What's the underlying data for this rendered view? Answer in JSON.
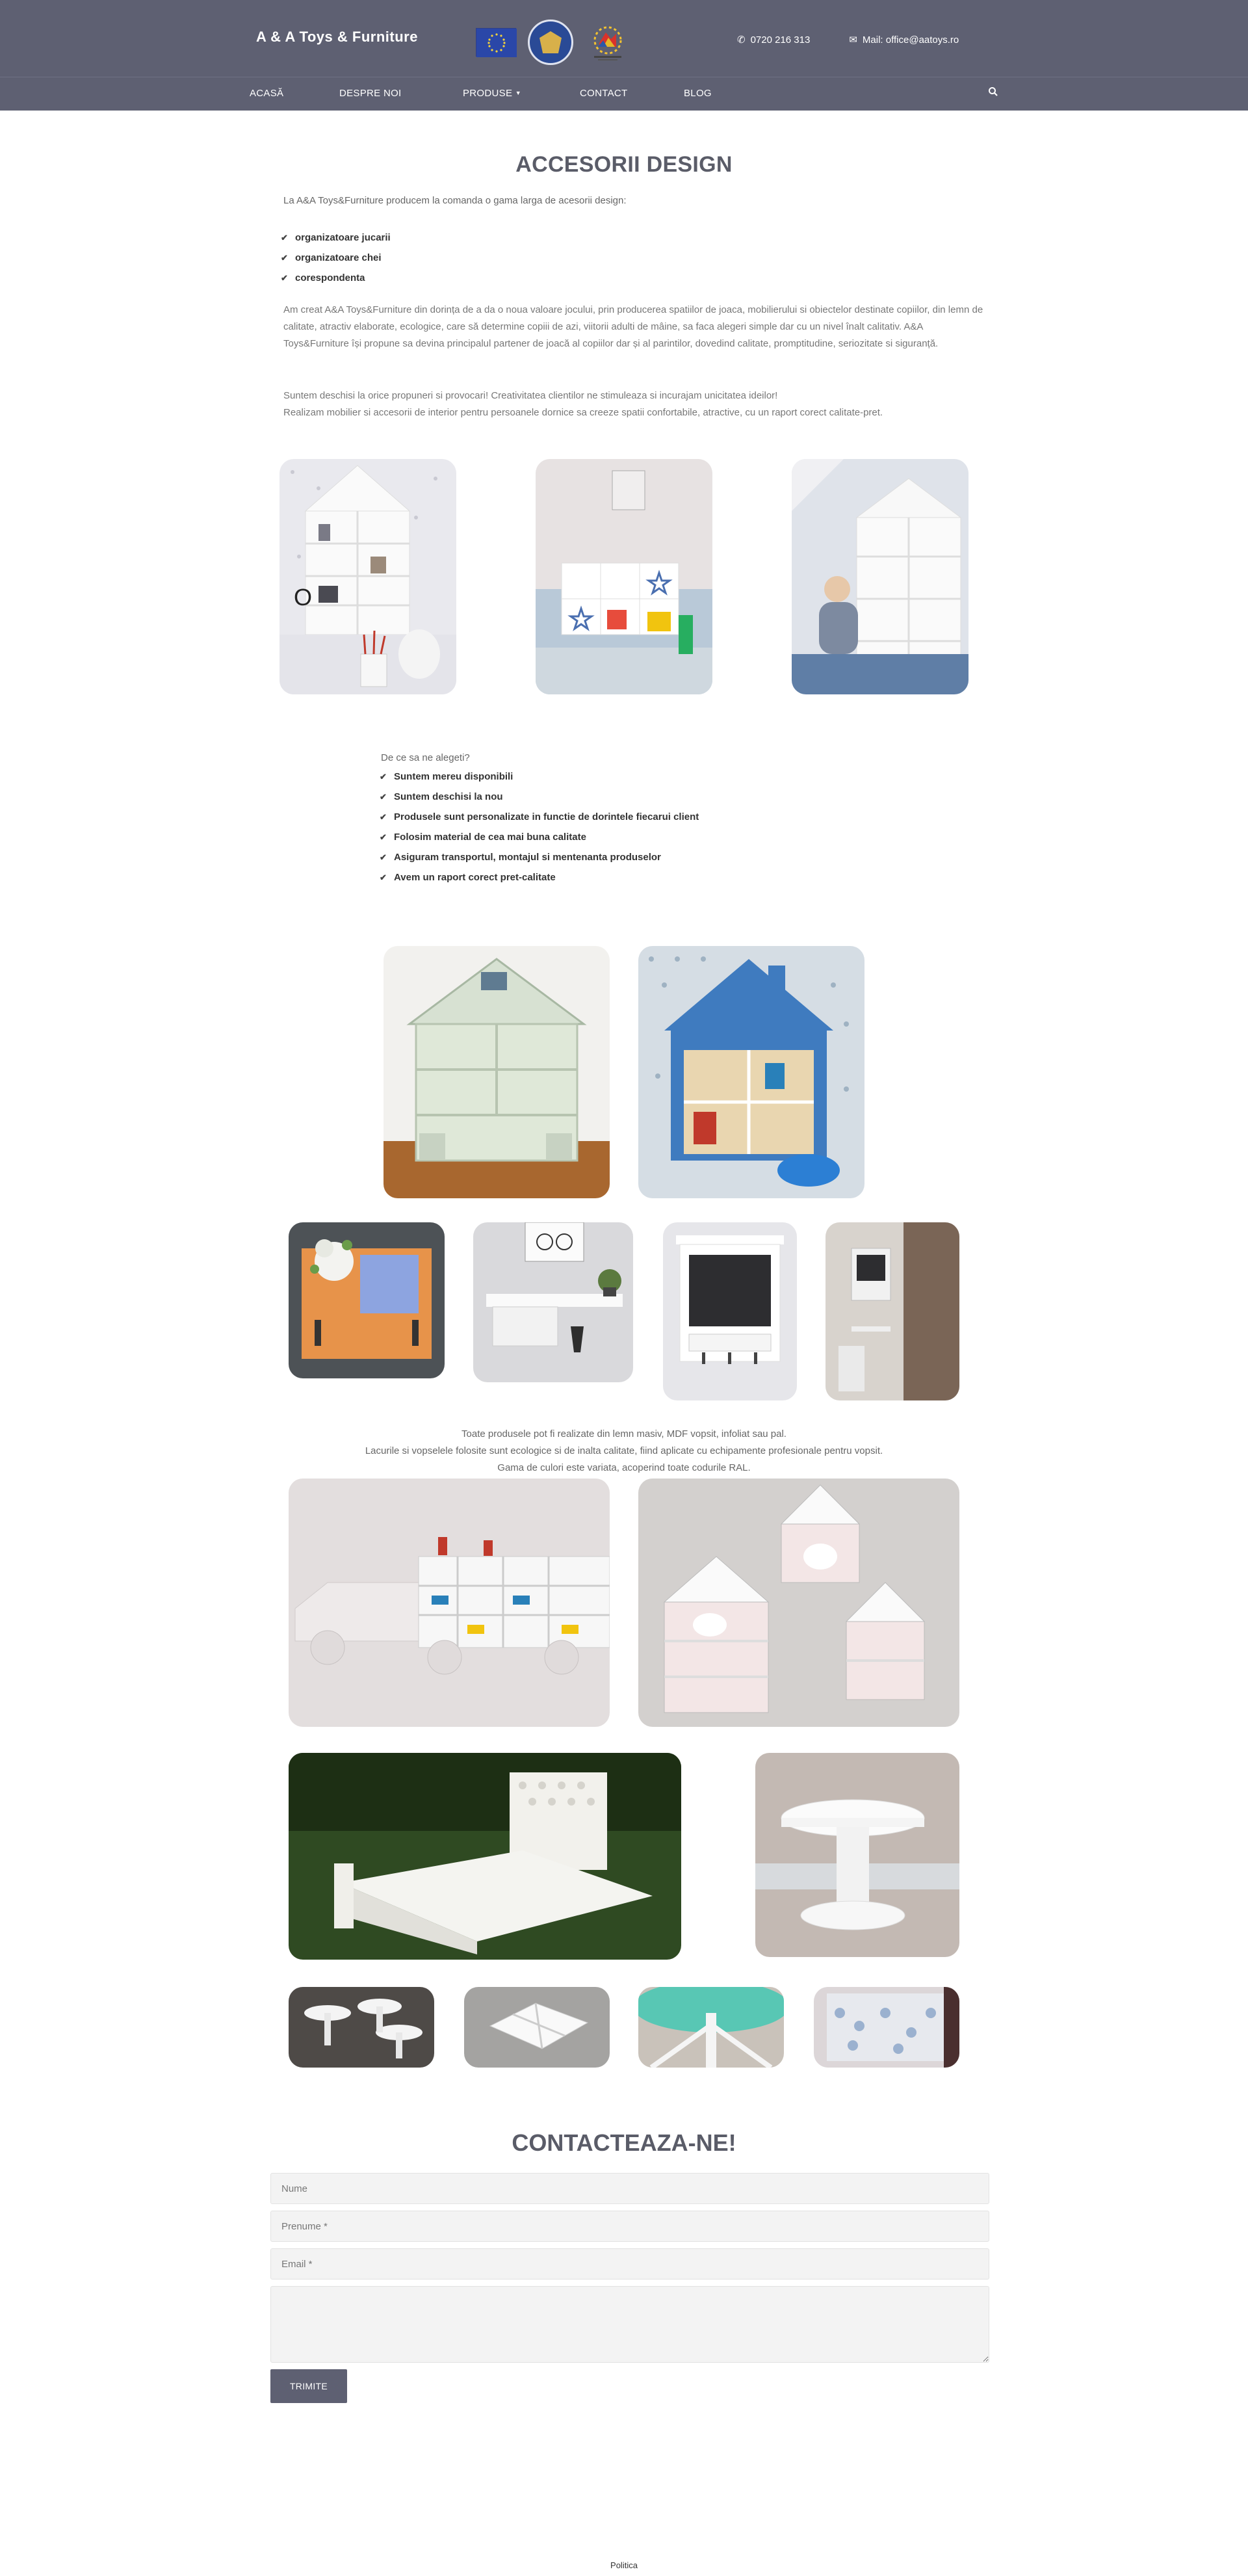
{
  "header": {
    "brand": "A & A Toys & Furniture",
    "phone": "0720 216 313",
    "mail": "Mail: office@aatoys.ro",
    "logos": [
      "eu-flag-logo",
      "romanian-government-seal-logo",
      "regio-programme-logo"
    ]
  },
  "nav": {
    "items": [
      {
        "label": "ACASĂ"
      },
      {
        "label": "DESPRE NOI"
      },
      {
        "label": "PRODUSE"
      },
      {
        "label": "CONTACT"
      },
      {
        "label": "BLOG"
      }
    ],
    "dropdown_icon": "chevron-down-icon",
    "search_icon": "search-icon"
  },
  "main": {
    "title": "ACCESORII DESIGN",
    "intro": "La A&A Toys&Furniture producem la comanda o gama larga de acesorii design:",
    "categories": [
      "organizatoare jucarii",
      "organizatoare chei",
      "corespondenta"
    ],
    "paragraph1": "Am creat A&A Toys&Furniture din dorința de a da o noua valoare jocului, prin producerea spatiilor de joaca, mobilierului si obiectelor destinate copiilor, din lemn de calitate, atractiv elaborate, ecologice, care să determine copiii de azi, viitorii adulti de mâine, sa faca alegeri simple dar cu un nivel înalt calitativ. A&A Toys&Furniture își propune sa devina principalul partener de joacă al copiilor dar și al parintilor, dovedind calitate, promptitudine, seriozitate si siguranță.",
    "paragraph2_line1": "Suntem deschisi la orice propuneri si provocari! Creativitatea clientilor ne stimuleaza si incurajam unicitatea ideilor!",
    "paragraph2_line2": "Realizam mobilier si accesorii de interior pentru persoanele dornice sa creeze spatii confortabile, atractive, cu un raport corect calitate-pret.",
    "why_title": "De ce sa ne alegeti?",
    "reasons": [
      "Suntem mereu disponibili",
      "Suntem deschisi la nou",
      "Produsele sunt personalizate in functie de dorintele fiecarui client",
      "Folosim material de cea mai buna calitate",
      "Asiguram transportul, montajul si mentenanta produselor",
      "Avem un raport corect pret-calitate"
    ],
    "disclaimer_lines": [
      "Toate produsele pot fi realizate din lemn masiv, MDF vopsit, infoliat sau pal.",
      "Lacurile si vopselele folosite sunt ecologice si de inalta calitate, fiind aplicate cu echipamente profesionale pentru vopsit.",
      "Gama de culori este variata, acoperind toate codurile RAL."
    ]
  },
  "contact": {
    "title": "CONTACTEAZA-NE!",
    "name_placeholder": "Nume",
    "firstname_placeholder": "Prenume *",
    "email_placeholder": "Email *",
    "message_placeholder": "",
    "submit_label": "TRIMITE"
  },
  "footer": {
    "policy_link": "Politica"
  },
  "colors": {
    "header_bg": "#5e6072",
    "title": "#5a5c68",
    "button_bg": "#5e6072"
  }
}
